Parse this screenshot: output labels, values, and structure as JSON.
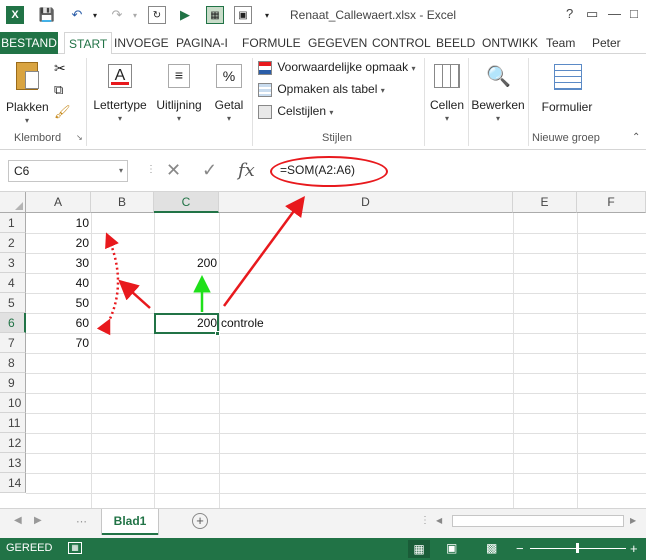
{
  "window": {
    "title": "Renaat_Callewaert.xlsx - Excel",
    "help": "?",
    "restore_ribbon": "▭",
    "minimize": "—",
    "maximize": "□"
  },
  "ribbon_tabs": [
    "BESTAND",
    "START",
    "INVOEGE",
    "PAGINA-I",
    "FORMULE",
    "GEGEVEN",
    "CONTROL",
    "BEELD",
    "ONTWIKK",
    "Team",
    "Peter DeS..."
  ],
  "ribbon": {
    "paste": "Plakken",
    "font": "Lettertype",
    "alignment": "Uitlijning",
    "number": "Getal",
    "number_symbol": "%",
    "conditional_formatting": "Voorwaardelijke opmaak",
    "format_as_table": "Opmaken als tabel",
    "cell_styles": "Celstijlen",
    "cells": "Cellen",
    "editing": "Bewerken",
    "form": "Formulier",
    "groups": {
      "clipboard": "Klembord",
      "styles": "Stijlen",
      "new_group": "Nieuwe groep"
    }
  },
  "formula_bar": {
    "name_box": "C6",
    "fx": "fx",
    "formula": "=SOM(A2:A6)"
  },
  "columns": [
    "A",
    "B",
    "C",
    "D",
    "E",
    "F"
  ],
  "rows": [
    "1",
    "2",
    "3",
    "4",
    "5",
    "6",
    "7",
    "8",
    "9",
    "10",
    "11",
    "12",
    "13",
    "14"
  ],
  "cells": {
    "A1": "10",
    "A2": "20",
    "A3": "30",
    "A4": "40",
    "A5": "50",
    "A6": "60",
    "A7": "70",
    "C3": "200",
    "C6": "200",
    "D6": "controle"
  },
  "annotations": {
    "colors": {
      "red": "#e8191d",
      "green": "#1fe01a"
    }
  },
  "sheet": {
    "tab": "Blad1"
  },
  "status": {
    "text": "GEREED",
    "zoom_minus": "−",
    "zoom_plus": "+"
  },
  "theme": {
    "accent": "#217346"
  }
}
